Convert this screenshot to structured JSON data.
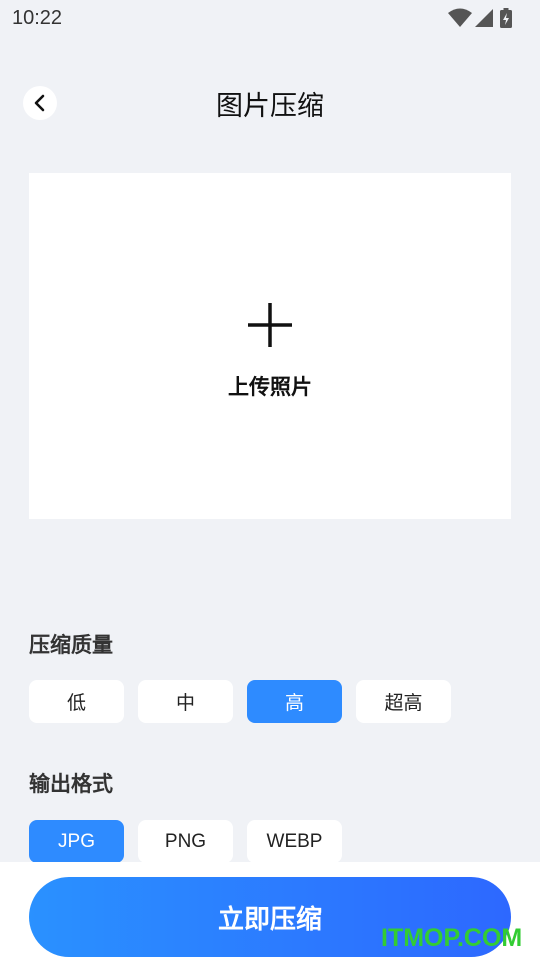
{
  "status_bar": {
    "time": "10:22",
    "icons": [
      "wifi-icon",
      "cellular-signal-icon",
      "battery-charging-icon"
    ]
  },
  "header": {
    "title": "图片压缩",
    "back_icon": "chevron-left-icon"
  },
  "upload": {
    "icon": "plus-icon",
    "label": "上传照片"
  },
  "quality": {
    "title": "压缩质量",
    "options": [
      "低",
      "中",
      "高",
      "超高"
    ],
    "selected": "高"
  },
  "format": {
    "title": "输出格式",
    "options": [
      "JPG",
      "PNG",
      "WEBP"
    ],
    "selected": "JPG"
  },
  "action": {
    "compress_label": "立即压缩"
  },
  "watermark": "ITMOP.COM",
  "colors": {
    "background": "#f0f2f6",
    "accent": "#2e8bff",
    "button_gradient_start": "#2a91ff",
    "button_gradient_end": "#2d68ff",
    "watermark": "#33cc33"
  }
}
